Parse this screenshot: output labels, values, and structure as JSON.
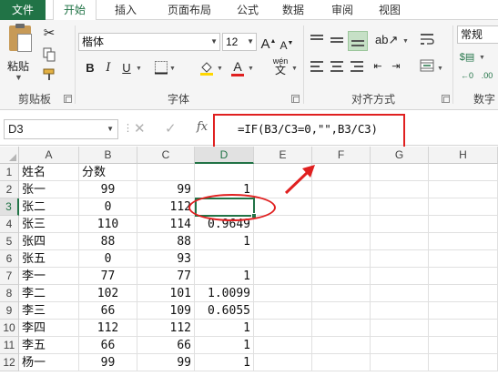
{
  "ribbon_tabs": [
    "文件",
    "开始",
    "插入",
    "页面布局",
    "公式",
    "数据",
    "审阅",
    "视图"
  ],
  "active_tab": "开始",
  "clipboard": {
    "paste_label": "粘贴",
    "group_label": "剪贴板"
  },
  "font": {
    "name": "楷体",
    "size": "12",
    "group_label": "字体",
    "bold": "B",
    "italic": "I",
    "underline": "U",
    "font_color_glyph": "A",
    "phonetic": "wén"
  },
  "alignment": {
    "group_label": "对齐方式"
  },
  "number": {
    "format": "常规",
    "group_label": "数字"
  },
  "formula_bar": {
    "name_box": "D3",
    "fx": "fx",
    "formula": "=IF(B3/C3=0,\"\",B3/C3)"
  },
  "columns": [
    "A",
    "B",
    "C",
    "D",
    "E",
    "F",
    "G",
    "H"
  ],
  "selected_column": "D",
  "selected_row": "3",
  "rows": [
    {
      "num": "1",
      "a": "姓名",
      "b": "分数",
      "c": "",
      "d": ""
    },
    {
      "num": "2",
      "a": "张一",
      "b": "99",
      "c": "99",
      "d": "1"
    },
    {
      "num": "3",
      "a": "张二",
      "b": "0",
      "c": "112",
      "d": ""
    },
    {
      "num": "4",
      "a": "张三",
      "b": "110",
      "c": "114",
      "d": "0.9649"
    },
    {
      "num": "5",
      "a": "张四",
      "b": "88",
      "c": "88",
      "d": "1"
    },
    {
      "num": "6",
      "a": "张五",
      "b": "0",
      "c": "93",
      "d": ""
    },
    {
      "num": "7",
      "a": "李一",
      "b": "77",
      "c": "77",
      "d": "1"
    },
    {
      "num": "8",
      "a": "李二",
      "b": "102",
      "c": "101",
      "d": "1.0099"
    },
    {
      "num": "9",
      "a": "李三",
      "b": "66",
      "c": "109",
      "d": "0.6055"
    },
    {
      "num": "10",
      "a": "李四",
      "b": "112",
      "c": "112",
      "d": "1"
    },
    {
      "num": "11",
      "a": "李五",
      "b": "66",
      "c": "66",
      "d": "1"
    },
    {
      "num": "12",
      "a": "杨一",
      "b": "99",
      "c": "99",
      "d": "1"
    }
  ],
  "colors": {
    "excel_green": "#217346",
    "annotation_red": "#e02020"
  }
}
